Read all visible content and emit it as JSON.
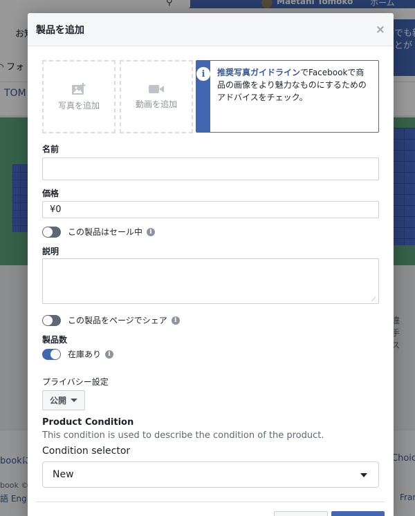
{
  "background": {
    "user_name": "Maetani Tomoko",
    "home_label": "ホーム",
    "notice_left": "お知",
    "notice_right": "でも新\nとが",
    "follow_label": "フォ",
    "page_tab": "TOM",
    "right_text": "違\n手\nス",
    "footer_link1": "bookに",
    "footer_copyright": "book ©",
    "footer_lang1": "語  Eng",
    "footer_right1": "Choice",
    "footer_right2": "Fran"
  },
  "modal": {
    "title": "製品を追加",
    "close_label": "×",
    "add_photo_label": "写真を追加",
    "add_video_label": "動画を追加",
    "tip": {
      "link_text": "推奨写真ガイドライン",
      "body_text": "でFacebookで商品の画像をより魅力なものにするためのアドバイスをチェック。"
    },
    "name_label": "名前",
    "name_value": "",
    "price_label": "価格",
    "price_value": "¥0",
    "sale_toggle_label": "この製品はセール中",
    "sale_toggle_on": false,
    "description_label": "説明",
    "description_value": "",
    "share_toggle_label": "この製品をページでシェア",
    "share_toggle_on": false,
    "inventory_label": "製品数",
    "in_stock_label": "在庫あり",
    "in_stock_on": true,
    "privacy_label": "プライバシー設定",
    "privacy_value": "公開",
    "condition_title": "Product Condition",
    "condition_desc": "This condition is used to describe the condition of the product.",
    "condition_selector_label": "Condition selector",
    "condition_value": "New"
  },
  "colors": {
    "accent": "#4267b2",
    "link": "#365899"
  }
}
